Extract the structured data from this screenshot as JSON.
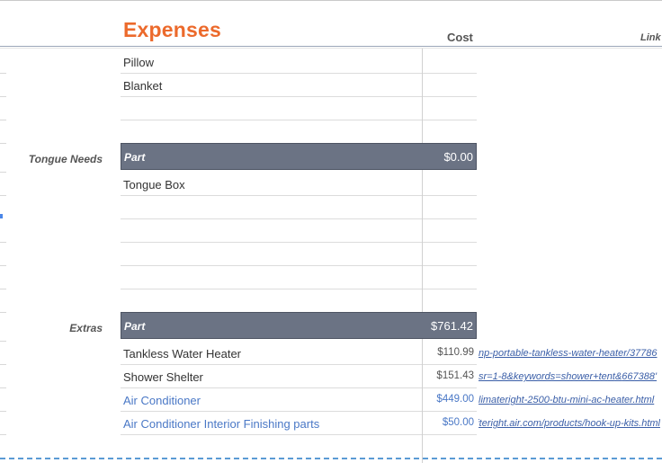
{
  "sheet": {
    "title": "Expenses",
    "columns": {
      "cost": "Cost",
      "link": "Link"
    }
  },
  "top_rows": [
    "Pillow",
    "Blanket",
    ""
  ],
  "sections": [
    {
      "label": "Tongue Needs",
      "band": {
        "part": "Part",
        "total": "$0.00"
      },
      "rows": [
        {
          "name": "Tongue Box",
          "cost": "",
          "link": ""
        },
        {
          "name": "",
          "cost": "",
          "link": ""
        },
        {
          "name": "",
          "cost": "",
          "link": ""
        },
        {
          "name": "",
          "cost": "",
          "link": ""
        },
        {
          "name": "",
          "cost": "",
          "link": ""
        }
      ]
    },
    {
      "label": "Extras",
      "band": {
        "part": "Part",
        "total": "$761.42"
      },
      "rows": [
        {
          "name": "Tankless Water Heater",
          "cost": "$110.99",
          "link": "np-portable-tankless-water-heater/37786",
          "is_link": false
        },
        {
          "name": "Shower Shelter",
          "cost": "$151.43",
          "link": "'667388&sr=1-8&keywords=shower+tent",
          "is_link": false
        },
        {
          "name": "Air Conditioner",
          "cost": "$449.00",
          "link": "limateright-2500-btu-mini-ac-heater.html",
          "is_link": true
        },
        {
          "name": "Air Conditioner Interior Finishing parts",
          "cost": "$50.00",
          "link": "iteright.air.com/products/hook-up-kits.html",
          "is_link": true
        }
      ]
    }
  ],
  "colors": {
    "title": "#ec6a2c",
    "band": "#6b7384",
    "link": "#4a78c6"
  }
}
